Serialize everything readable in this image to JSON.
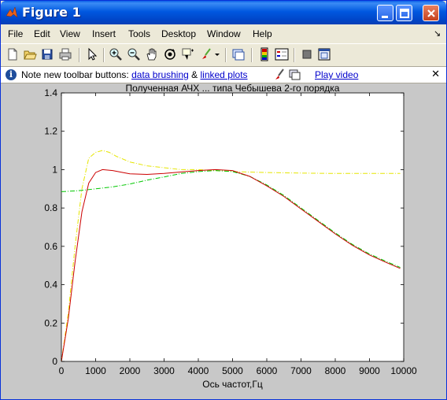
{
  "window": {
    "title": "Figure 1",
    "title_icon": "matlab-logo-icon",
    "controls": [
      "minimize-icon",
      "maximize-icon",
      "close-icon"
    ]
  },
  "menubar": {
    "items": [
      {
        "label": "File",
        "accel": "F"
      },
      {
        "label": "Edit",
        "accel": "E"
      },
      {
        "label": "View",
        "accel": "V"
      },
      {
        "label": "Insert",
        "accel": "I"
      },
      {
        "label": "Tools",
        "accel": "T"
      },
      {
        "label": "Desktop",
        "accel": "D"
      },
      {
        "label": "Window",
        "accel": "W"
      },
      {
        "label": "Help",
        "accel": "H"
      }
    ],
    "dock_arrow": "↘"
  },
  "toolbar": {
    "icons": [
      "new-figure-icon",
      "open-file-icon",
      "save-icon",
      "print-icon",
      "edit-plot-icon",
      "zoom-in-icon",
      "zoom-out-icon",
      "pan-icon",
      "rotate-3d-icon",
      "data-cursor-icon",
      "brush-icon",
      "link-plot-icon",
      "colorbar-icon",
      "legend-icon",
      "hide-plot-tools-icon",
      "show-plot-tools-icon"
    ]
  },
  "infobar": {
    "text_before": "Note new toolbar buttons: ",
    "link1": "data brushing",
    "amp": " & ",
    "link2": "linked plots",
    "link3": "Play video",
    "close": "✕"
  },
  "chart_data": {
    "type": "line",
    "title": "Полученная АЧХ ... типа Чебышева 2-го порядка",
    "xlabel": "Ось частот,Гц",
    "ylabel": "",
    "xlim": [
      0,
      10000
    ],
    "ylim": [
      0,
      1.4
    ],
    "xticks": [
      0,
      1000,
      2000,
      3000,
      4000,
      5000,
      6000,
      7000,
      8000,
      9000,
      10000
    ],
    "yticks": [
      0,
      0.2,
      0.4,
      0.6,
      0.8,
      1,
      1.2,
      1.4
    ],
    "xtick_labels": [
      "0",
      "1000",
      "2000",
      "3000",
      "4000",
      "5000",
      "6000",
      "7000",
      "8000",
      "9000",
      "10000"
    ],
    "ytick_labels": [
      "0",
      "0.2",
      "0.4",
      "0.6",
      "0.8",
      "1",
      "1.2",
      "1.4"
    ],
    "grid": false,
    "series": [
      {
        "color": "#e6e600",
        "style": "dashdot",
        "x": [
          0,
          200,
          400,
          600,
          800,
          1000,
          1200,
          1400,
          1600,
          2000,
          2500,
          3000,
          3500,
          4000,
          4500,
          5000,
          6000,
          7000,
          8000,
          9000,
          9900
        ],
        "y": [
          0,
          0.25,
          0.6,
          0.9,
          1.06,
          1.09,
          1.1,
          1.09,
          1.07,
          1.04,
          1.02,
          1.01,
          1.0,
          1.0,
          0.995,
          0.99,
          0.985,
          0.982,
          0.98,
          0.98,
          0.98
        ]
      },
      {
        "color": "#00c800",
        "style": "dashdot",
        "x": [
          0,
          500,
          1000,
          1500,
          2000,
          2500,
          3000,
          3500,
          4000,
          4500,
          5000,
          5500,
          6000,
          6500,
          7000,
          7500,
          8000,
          8500,
          9000,
          9500,
          9900
        ],
        "y": [
          0.885,
          0.89,
          0.9,
          0.91,
          0.925,
          0.945,
          0.962,
          0.98,
          0.99,
          0.995,
          0.99,
          0.965,
          0.92,
          0.865,
          0.8,
          0.735,
          0.67,
          0.61,
          0.56,
          0.52,
          0.49
        ]
      },
      {
        "color": "#cc0000",
        "style": "solid",
        "x": [
          0,
          200,
          400,
          600,
          800,
          1000,
          1200,
          1500,
          1800,
          2000,
          2500,
          3000,
          3500,
          4000,
          4500,
          5000,
          5500,
          6000,
          6500,
          7000,
          7500,
          8000,
          8500,
          9000,
          9500,
          9900
        ],
        "y": [
          0,
          0.22,
          0.52,
          0.78,
          0.93,
          0.985,
          1.0,
          0.995,
          0.985,
          0.978,
          0.975,
          0.98,
          0.988,
          0.995,
          1.0,
          0.995,
          0.965,
          0.915,
          0.86,
          0.795,
          0.73,
          0.665,
          0.605,
          0.555,
          0.515,
          0.485
        ]
      }
    ]
  }
}
